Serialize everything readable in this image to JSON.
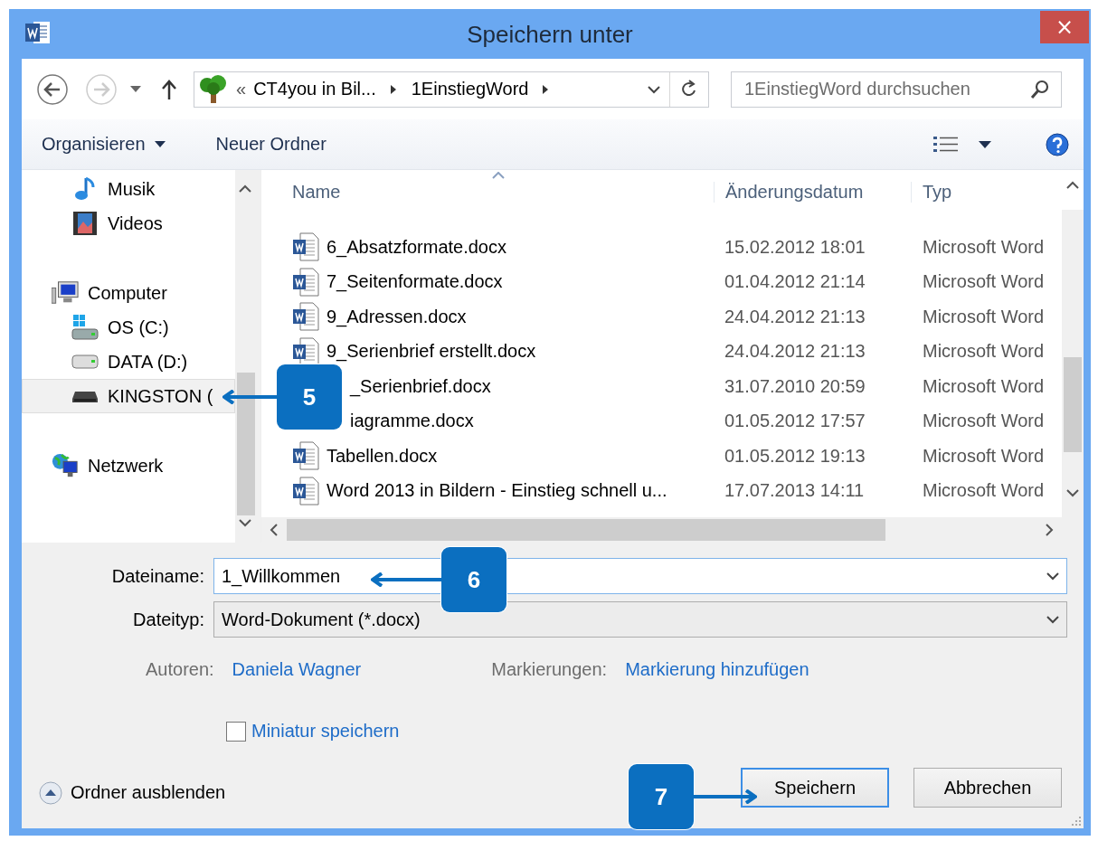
{
  "window": {
    "title": "Speichern unter",
    "close": "×"
  },
  "address_bar": {
    "overflow_marker": "«",
    "crumbs": [
      "CT4you in Bil...",
      "1EinstiegWord"
    ]
  },
  "search": {
    "placeholder": "1EinstiegWord durchsuchen"
  },
  "toolbar": {
    "organize": "Organisieren",
    "new_folder": "Neuer Ordner"
  },
  "nav": {
    "libraries": [
      {
        "label": "Musik",
        "kind": "music",
        "selected": false
      },
      {
        "label": "Videos",
        "kind": "video",
        "selected": false
      }
    ],
    "tree": [
      {
        "label": "Computer",
        "kind": "computer",
        "selected": false,
        "children": [
          {
            "label": "OS (C:)",
            "kind": "system-drive",
            "selected": false
          },
          {
            "label": "DATA (D:)",
            "kind": "drive",
            "selected": false
          },
          {
            "label": "KINGSTON (",
            "kind": "usb",
            "selected": true
          }
        ]
      },
      {
        "label": "Netzwerk",
        "kind": "network",
        "selected": false
      }
    ]
  },
  "table": {
    "columns": [
      "Name",
      "Änderungsdatum",
      "Typ"
    ],
    "rows": [
      {
        "name": "6_Absatzformate.docx",
        "date": "15.02.2012 18:01",
        "type": "Microsoft Word",
        "icon": true
      },
      {
        "name": "7_Seitenformate.docx",
        "date": "01.04.2012 21:14",
        "type": "Microsoft Word",
        "icon": true
      },
      {
        "name": "9_Adressen.docx",
        "date": "24.04.2012 21:13",
        "type": "Microsoft Word",
        "icon": true
      },
      {
        "name": "9_Serienbrief erstellt.docx",
        "date": "24.04.2012 21:13",
        "type": "Microsoft Word",
        "icon": true
      },
      {
        "name": "_Serienbrief.docx",
        "date": "31.07.2010 20:59",
        "type": "Microsoft Word",
        "icon": false
      },
      {
        "name": "iagramme.docx",
        "date": "01.05.2012 17:57",
        "type": "Microsoft Word",
        "icon": false
      },
      {
        "name": "Tabellen.docx",
        "date": "01.05.2012 19:13",
        "type": "Microsoft Word",
        "icon": true
      },
      {
        "name": "Word 2013 in Bildern - Einstieg schnell u...",
        "date": "17.07.2013 14:11",
        "type": "Microsoft Word",
        "icon": true
      }
    ]
  },
  "filename": {
    "label": "Dateiname:",
    "value": "1_Willkommen"
  },
  "filetype": {
    "label": "Dateityp:",
    "value": "Word-Dokument (*.docx)"
  },
  "authors": {
    "label": "Autoren:",
    "value": "Daniela Wagner"
  },
  "tags": {
    "label": "Markierungen:",
    "value": "Markierung hinzufügen"
  },
  "thumbnail": {
    "label": "Miniatur speichern",
    "checked": false
  },
  "hide_folders": "Ordner ausblenden",
  "buttons": [
    {
      "label": "Speichern",
      "default": true
    },
    {
      "label": "Abbrechen",
      "default": false
    }
  ],
  "callouts": [
    {
      "label": "5"
    },
    {
      "label": "6"
    },
    {
      "label": "7"
    }
  ]
}
